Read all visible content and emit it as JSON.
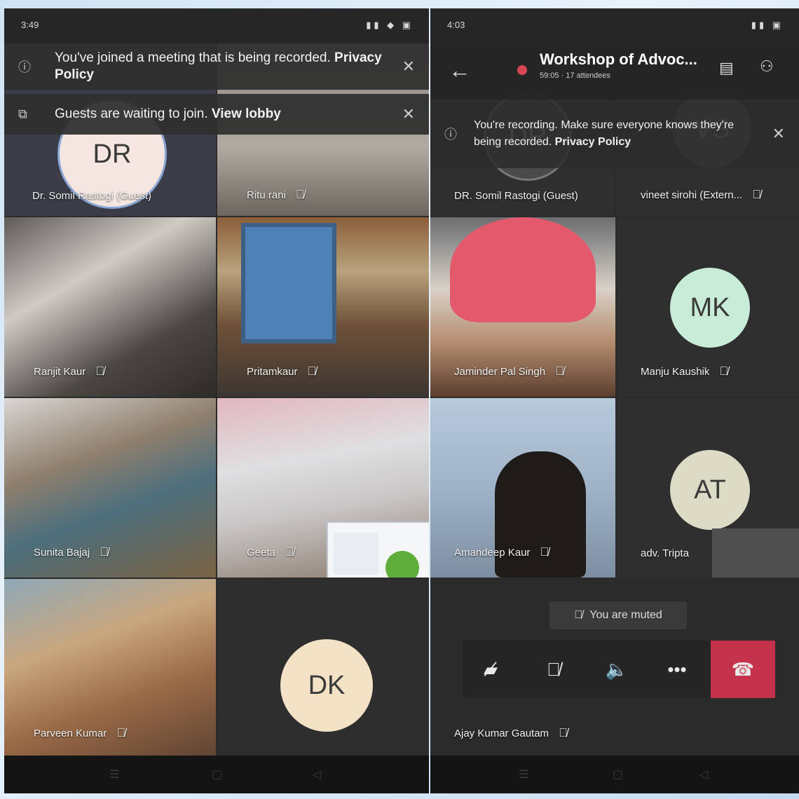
{
  "left": {
    "status_time": "3:49",
    "status_icons": "▮▮ ◆ ▣",
    "banner_recorded": {
      "text": "You've joined a meeting that is being recorded.",
      "link": "Privacy Policy"
    },
    "banner_lobby": {
      "text": "Guests are waiting to join.",
      "link": "View lobby"
    },
    "participants": [
      {
        "name": "Dr. Somil Rastogi (Guest)",
        "initials": "DR"
      },
      {
        "name": "Ritu rani"
      },
      {
        "name": "Ranjit Kaur"
      },
      {
        "name": "Pritamkaur"
      },
      {
        "name": "Sunita Bajaj"
      },
      {
        "name": "Geeta"
      },
      {
        "name": "Parveen Kumar"
      },
      {
        "name": "",
        "initials": "DK"
      }
    ]
  },
  "right": {
    "status_time": "4:03",
    "status_icons": "▮▮ ▣",
    "meeting_title": "Workshop of Advoc...",
    "meeting_meta": "59:05 · 17 attendees",
    "banner_recording": {
      "text": "You're recording. Make sure everyone knows they're being recorded.",
      "link": "Privacy Policy"
    },
    "participants": [
      {
        "name": "DR. Somil Rastogi (Guest)",
        "initials": "DR"
      },
      {
        "name": "vineet sirohi (Extern...",
        "initials": "VS"
      },
      {
        "name": "Jaminder Pal Singh"
      },
      {
        "name": "Manju Kaushik",
        "initials": "MK"
      },
      {
        "name": "Amandeep Kaur"
      },
      {
        "name": "adv. Tripta",
        "initials": "AT"
      },
      {
        "name": "Ajay Kumar Gautam"
      }
    ],
    "muted_toast": "You are muted"
  },
  "colors": {
    "end_call": "#c4314b",
    "avatar_mk": "#c9ecd9",
    "avatar_at": "#dcdcc6",
    "avatar_dk": "#f3e2c6",
    "recording_dot": "#d74654"
  }
}
